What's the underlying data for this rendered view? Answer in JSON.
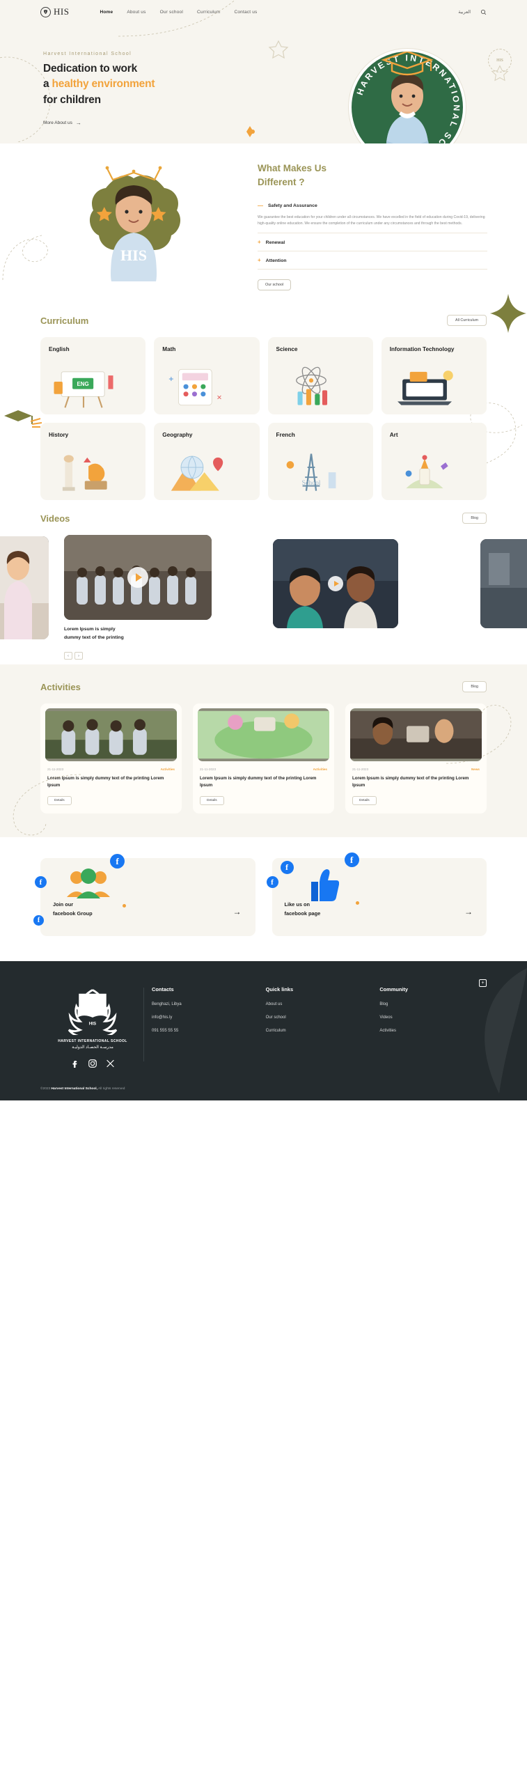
{
  "header": {
    "logo_text": "HIS",
    "logo_icon": "shield-leaf-icon",
    "nav": [
      {
        "label": "Home",
        "active": true
      },
      {
        "label": "About us",
        "active": false
      },
      {
        "label": "Our school",
        "active": false
      },
      {
        "label": "Curriculum",
        "active": false
      },
      {
        "label": "Contact us",
        "active": false
      }
    ],
    "language_label": "العربية",
    "search_icon": "search-icon"
  },
  "hero": {
    "kicker": "Harvest International School",
    "title_line1": "Dedication to work",
    "title_line2_a": "a ",
    "title_line2_accent": "healthy environment",
    "title_line3": "for children",
    "cta": "More About us",
    "cta_arrow": "→",
    "badge_ring_text": "HARVEST INTERNATIONAL SCHOOL",
    "stamp_text": "HIS"
  },
  "different": {
    "badge_text": "HIS",
    "title_line1": "What Makes Us",
    "title_line2": "Different ?",
    "items": [
      {
        "sign": "—",
        "label": "Safety and Assurance",
        "open": true,
        "body": "We guarantee the best education for your children under all circumstances. We have excelled in the field of education during Covid-19, delivering high-quality online education. We ensure the completion of the curriculum under any circumstances and through the best methods."
      },
      {
        "sign": "+",
        "label": "Renewal",
        "open": false,
        "body": ""
      },
      {
        "sign": "+",
        "label": "Attention",
        "open": false,
        "body": ""
      }
    ],
    "button": "Our school"
  },
  "curriculum": {
    "title": "Curriculum",
    "button": "All Curriculum",
    "cards": [
      {
        "name": "English",
        "art": "eng-board-icon"
      },
      {
        "name": "Math",
        "art": "calculator-icon"
      },
      {
        "name": "Science",
        "art": "atom-flask-icon"
      },
      {
        "name": "Information Technology",
        "art": "laptop-icon"
      },
      {
        "name": "History",
        "art": "column-statue-icon"
      },
      {
        "name": "Geography",
        "art": "globe-map-icon"
      },
      {
        "name": "French",
        "art": "eiffel-tower-icon"
      },
      {
        "name": "Art",
        "art": "palette-brush-icon"
      }
    ]
  },
  "videos": {
    "title": "Videos",
    "button": "Blog",
    "caption_line1": "Lorem Ipsum is simply",
    "caption_line2": "dummy text of the printing",
    "prev_arrow": "‹",
    "next_arrow": "›",
    "play_icon": "play-icon"
  },
  "activities": {
    "title": "Activities",
    "button": "Blog",
    "cards": [
      {
        "date": "21-11-2023",
        "tag": "Activities",
        "text": "Lorem Ipsum is simply dummy text of the printing Lorem Ipsum",
        "button": "Details"
      },
      {
        "date": "21-11-2023",
        "tag": "Activities",
        "text": "Lorem Ipsum is simply dummy text of the printing Lorem Ipsum",
        "button": "Details"
      },
      {
        "date": "21-11-2023",
        "tag": "News",
        "text": "Lorem Ipsum is simply dummy text of the printing Lorem Ipsum",
        "button": "Details"
      }
    ]
  },
  "social": {
    "cards": [
      {
        "line1": "Join our",
        "line2": "facebook Group",
        "arrow": "→",
        "icon": "facebook-group-icon"
      },
      {
        "line1": "Like us on",
        "line2": "facebook page",
        "arrow": "→",
        "icon": "facebook-like-icon"
      }
    ],
    "fb_glyph": "f"
  },
  "footer": {
    "logo_name_en": "HARVEST INTERNATIONAL SCHOOL",
    "logo_name_ar": "مدرسـة الحصـاد الدوليـة",
    "logo_inner": "HIS",
    "socials": [
      {
        "icon": "facebook-icon",
        "glyph": "f"
      },
      {
        "icon": "instagram-icon",
        "glyph": "◻"
      },
      {
        "icon": "x-twitter-icon",
        "glyph": "✕"
      }
    ],
    "columns": [
      {
        "heading": "Contacts",
        "links": [
          "Benghazi, Libya",
          "info@his.ly",
          "091 555 55 55"
        ]
      },
      {
        "heading": "Quick links",
        "links": [
          "About us",
          "Our school",
          "Curriculum"
        ]
      },
      {
        "heading": "Community",
        "links": [
          "Blog",
          "Videos",
          "Activities"
        ]
      }
    ],
    "copyright_pre": "©2023 ",
    "copyright_bold": "Harvest International School,",
    "copyright_post": " All rights reserved",
    "plus": "+"
  },
  "colors": {
    "cream": "#f7f5ef",
    "olive": "#9a9456",
    "orange": "#f2a33c",
    "green": "#2f6b45",
    "dark": "#242b2e",
    "facebook": "#1877f2"
  }
}
